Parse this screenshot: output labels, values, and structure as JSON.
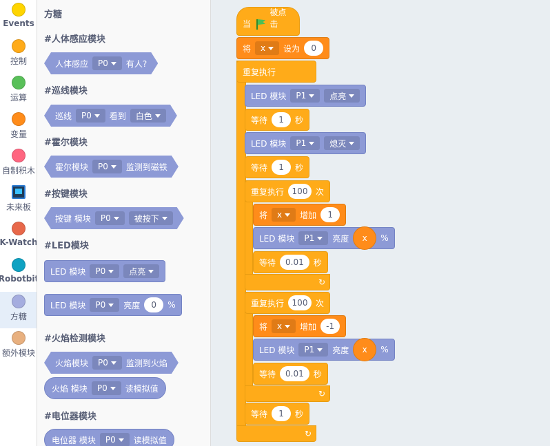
{
  "categories": [
    {
      "label": "Events",
      "color": "#ffd500",
      "bold": true
    },
    {
      "label": "控制",
      "color": "#ffab19"
    },
    {
      "label": "运算",
      "color": "#59c059"
    },
    {
      "label": "变量",
      "color": "#ff8c1a"
    },
    {
      "label": "自制积木",
      "color": "#ff6680"
    },
    {
      "label": "未来板",
      "color": "#1f3b57"
    },
    {
      "label": "K-Watch",
      "color": "#e8684a",
      "bold": true
    },
    {
      "label": "Robotbit",
      "color": "#0fa2c2",
      "bold": true
    },
    {
      "label": "方糖",
      "color": "#a5addf"
    },
    {
      "label": "额外模块",
      "color": "#e8b07f"
    }
  ],
  "flyout": {
    "title": "方糖",
    "sections": {
      "human": {
        "title": "#人体感应模块",
        "block": {
          "pre": "人体感应",
          "port": "P0",
          "post": "有人?"
        }
      },
      "line": {
        "title": "#巡线模块",
        "block": {
          "pre": "巡线",
          "port": "P0",
          "mid": "看到",
          "opt": "白色"
        }
      },
      "hall": {
        "title": "#霍尔模块",
        "block": {
          "pre": "霍尔模块",
          "port": "P0",
          "post": "监测到磁铁"
        }
      },
      "key": {
        "title": "#按键模块",
        "block": {
          "pre": "按键 模块",
          "port": "P0",
          "opt": "被按下"
        }
      },
      "led": {
        "title": "#LED模块",
        "block1": {
          "pre": "LED 模块",
          "port": "P0",
          "opt": "点亮"
        },
        "block2": {
          "pre": "LED 模块",
          "port": "P0",
          "mid": "亮度",
          "val": "0",
          "unit": "%"
        }
      },
      "fire": {
        "title": "#火焰检测模块",
        "block1": {
          "pre": "火焰模块",
          "port": "P0",
          "post": "监测到火焰"
        },
        "block2": {
          "pre": "火焰 模块",
          "port": "P0",
          "post": "读模拟值"
        }
      },
      "pot": {
        "title": "#电位器模块",
        "block": {
          "pre": "电位器 模块",
          "port": "P0",
          "post": "读模拟值"
        }
      }
    }
  },
  "script": {
    "hat": {
      "pre": "当",
      "post": "被点击"
    },
    "set": {
      "pre": "将",
      "var": "x",
      "mid": "设为",
      "val": "0"
    },
    "forever": "重复执行",
    "led_on": {
      "pre": "LED 模块",
      "port": "P1",
      "opt": "点亮"
    },
    "wait1": {
      "pre": "等待",
      "val": "1",
      "unit": "秒"
    },
    "led_off": {
      "pre": "LED 模块",
      "port": "P1",
      "opt": "熄灭"
    },
    "wait2": {
      "pre": "等待",
      "val": "1",
      "unit": "秒"
    },
    "repeat1": {
      "pre": "重复执行",
      "val": "100",
      "unit": "次"
    },
    "inc1": {
      "pre": "将",
      "var": "x",
      "mid": "增加",
      "val": "1"
    },
    "bright1": {
      "pre": "LED 模块",
      "port": "P1",
      "mid": "亮度",
      "var": "x",
      "unit": "%"
    },
    "wait3": {
      "pre": "等待",
      "val": "0.01",
      "unit": "秒"
    },
    "repeat2": {
      "pre": "重复执行",
      "val": "100",
      "unit": "次"
    },
    "inc2": {
      "pre": "将",
      "var": "x",
      "mid": "增加",
      "val": "-1"
    },
    "bright2": {
      "pre": "LED 模块",
      "port": "P1",
      "mid": "亮度",
      "var": "x",
      "unit": "%"
    },
    "wait4": {
      "pre": "等待",
      "val": "0.01",
      "unit": "秒"
    },
    "wait5": {
      "pre": "等待",
      "val": "1",
      "unit": "秒"
    }
  },
  "icons": {
    "loop": "loop-arrow-icon",
    "flag": "green-flag-icon",
    "dropdown": "chevron-down-icon"
  }
}
